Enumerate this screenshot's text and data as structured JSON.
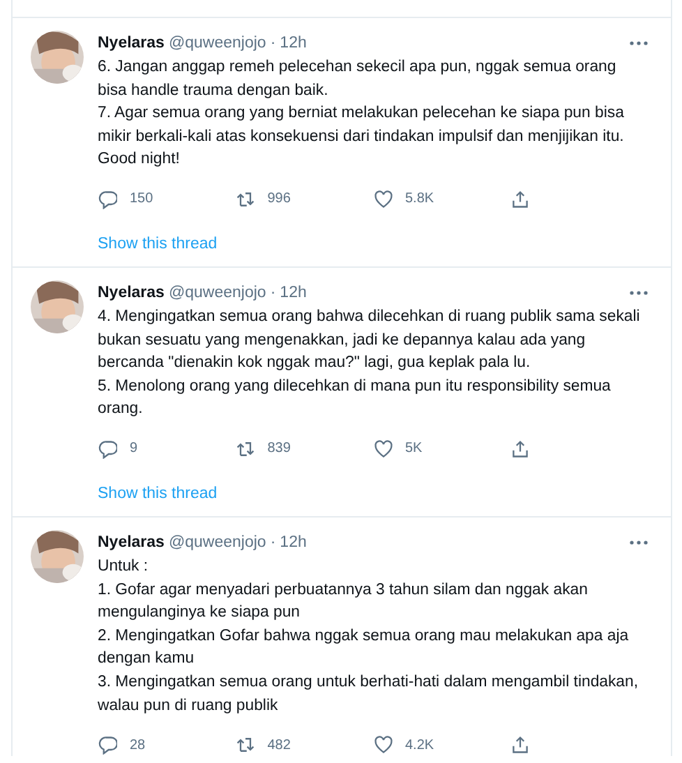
{
  "tweets": [
    {
      "name": "Nyelaras",
      "handle": "@quweenjojo",
      "separator": "·",
      "time": "12h",
      "text": "6. Jangan anggap remeh pelecehan sekecil apa pun, nggak semua orang bisa handle trauma dengan baik.\n7. Agar semua orang yang berniat melakukan pelecehan ke siapa pun bisa mikir berkali-kali atas konsekuensi dari tindakan impulsif dan menjijikan itu.\nGood night!",
      "replies": "150",
      "retweets": "996",
      "likes": "5.8K",
      "show_thread": "Show this thread"
    },
    {
      "name": "Nyelaras",
      "handle": "@quweenjojo",
      "separator": "·",
      "time": "12h",
      "text": "4. Mengingatkan semua orang bahwa dilecehkan di ruang publik sama sekali bukan sesuatu yang mengenakkan, jadi ke depannya kalau ada yang bercanda \"dienakin kok nggak mau?\" lagi, gua keplak pala lu.\n5. Menolong orang yang dilecehkan di mana pun itu responsibility semua orang.",
      "replies": "9",
      "retweets": "839",
      "likes": "5K",
      "show_thread": "Show this thread"
    },
    {
      "name": "Nyelaras",
      "handle": "@quweenjojo",
      "separator": "·",
      "time": "12h",
      "text": "Untuk :\n1. Gofar agar menyadari perbuatannya 3 tahun silam dan nggak akan mengulanginya ke siapa pun\n2. Mengingatkan Gofar bahwa nggak semua orang mau melakukan apa aja dengan kamu\n3. Mengingatkan semua orang untuk berhati-hati dalam mengambil tindakan, walau pun di ruang publik",
      "replies": "28",
      "retweets": "482",
      "likes": "4.2K"
    }
  ]
}
